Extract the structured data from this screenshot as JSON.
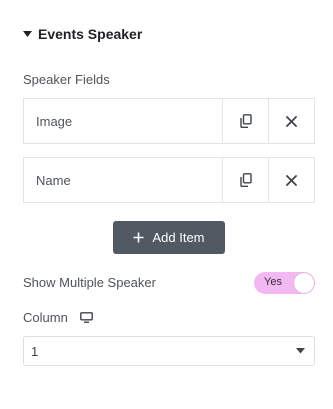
{
  "section": {
    "title": "Events Speaker",
    "expanded": true
  },
  "speaker_fields": {
    "label": "Speaker Fields",
    "items": [
      {
        "title": "Image"
      },
      {
        "title": "Name"
      }
    ],
    "add_label": "Add Item"
  },
  "multiple_speaker": {
    "label": "Show Multiple Speaker",
    "value_label": "Yes",
    "on": true
  },
  "column": {
    "label": "Column",
    "device_icon": "desktop-icon",
    "selected": "1"
  },
  "colors": {
    "toggle_bg": "#f2b8f2",
    "button_bg": "#515962"
  }
}
